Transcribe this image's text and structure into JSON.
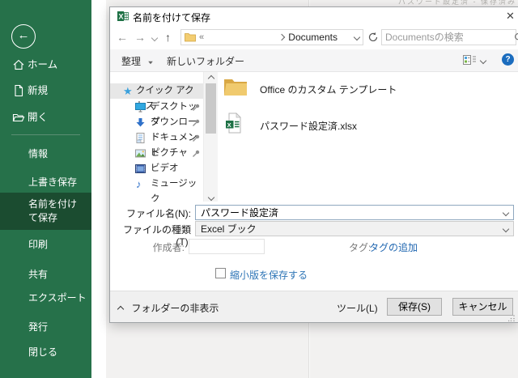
{
  "window": {
    "background_title_remnant": "パスワード設定済 - 保存済み"
  },
  "sidebar": {
    "items_top": [
      {
        "label": "ホーム"
      },
      {
        "label": "新規"
      },
      {
        "label": "開く"
      }
    ],
    "items": [
      {
        "label": "情報"
      },
      {
        "label": "上書き保存"
      },
      {
        "label": "名前を付けて保存",
        "selected": true
      },
      {
        "label": "印刷"
      },
      {
        "label": "共有"
      },
      {
        "label": "エクスポート"
      },
      {
        "label": "発行"
      },
      {
        "label": "閉じる"
      }
    ]
  },
  "dialog": {
    "title": "名前を付けて保存",
    "close_label": "✕",
    "address_bar": {
      "breadcrumb_collapsed": "«",
      "breadcrumb_item": "Documents",
      "search_placeholder": "Documentsの検索"
    },
    "command_bar": {
      "organize_label": "整理",
      "new_folder_label": "新しいフォルダー"
    },
    "nav_pane": {
      "quick_access_label": "クイック アクセス",
      "items": [
        {
          "label": "デスクトップ",
          "pinned": true
        },
        {
          "label": "ダウンロード",
          "pinned": true
        },
        {
          "label": "ドキュメント",
          "pinned": true
        },
        {
          "label": "ピクチャ",
          "pinned": true
        },
        {
          "label": "ビデオ",
          "pinned": false
        },
        {
          "label": "ミュージック",
          "pinned": false
        }
      ]
    },
    "file_list": [
      {
        "name": "Office のカスタム テンプレート",
        "icon": "folder"
      },
      {
        "name": "パスワード設定済.xlsx",
        "icon": "excel-file"
      }
    ],
    "fields": {
      "file_name_label": "ファイル名(N):",
      "file_name_value": "パスワード設定済",
      "file_type_label": "ファイルの種類(T):",
      "file_type_value": "Excel ブック",
      "author_label": "作成者:",
      "tags_label": "タグ:",
      "add_tag_link": "タグの追加",
      "save_thumbnail_label": "縮小版を保存する"
    },
    "footer": {
      "hide_folders_label": "フォルダーの非表示",
      "tools_label": "ツール(L)",
      "save_label": "保存(S)",
      "cancel_label": "キャンセル"
    }
  },
  "colors": {
    "excel_green": "#26714a",
    "sidebar_selected_green": "#1b4c30",
    "excel_icon_green": "#1e7145",
    "link_blue": "#1f66b0",
    "help_blue": "#1b6cbe",
    "folder_yellow": "#efc564"
  }
}
